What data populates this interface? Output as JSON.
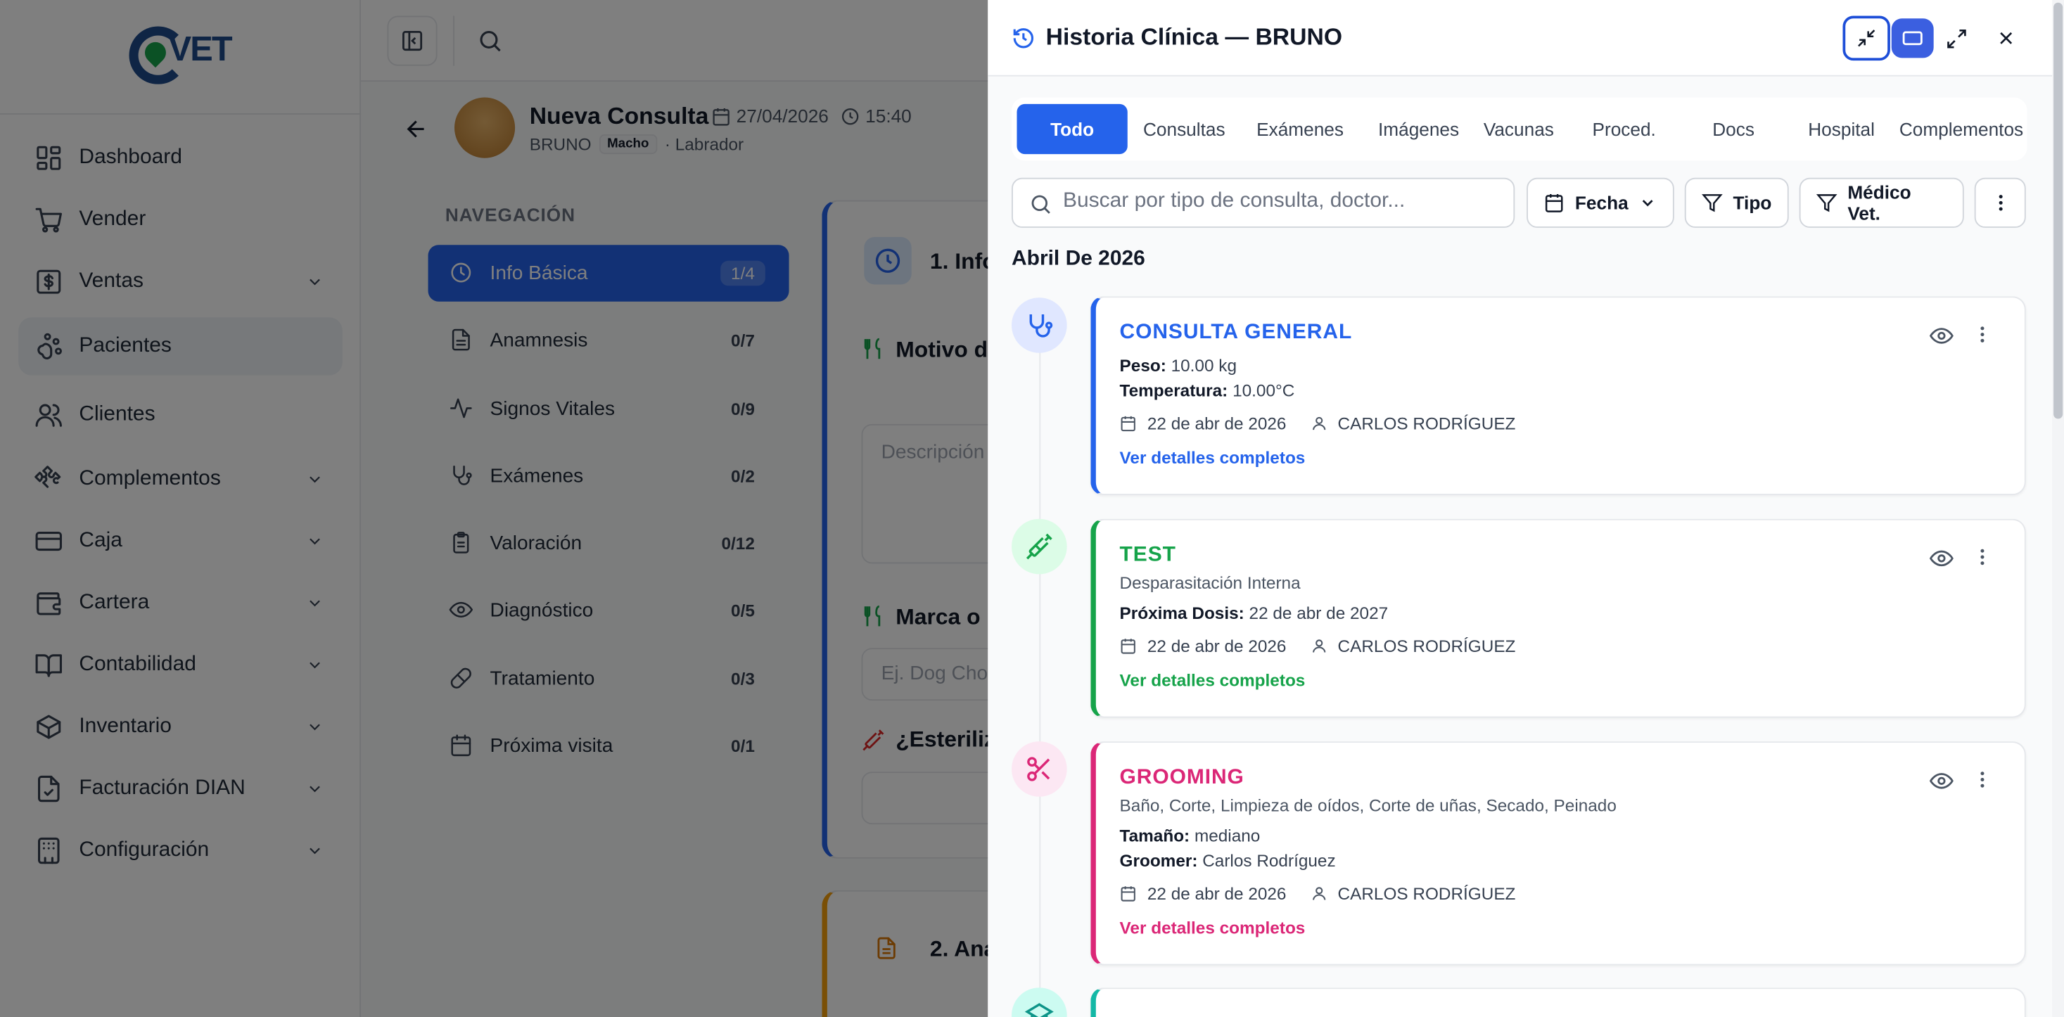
{
  "sidebar": {
    "logo_text": "VET",
    "items": [
      {
        "label": "Dashboard",
        "icon": "grid-icon",
        "chevron": false
      },
      {
        "label": "Vender",
        "icon": "cart-icon",
        "chevron": false
      },
      {
        "label": "Ventas",
        "icon": "dollar-icon",
        "chevron": true
      },
      {
        "label": "Pacientes",
        "icon": "paw-icon",
        "chevron": false,
        "active": true
      },
      {
        "label": "Clientes",
        "icon": "users-icon",
        "chevron": false
      },
      {
        "label": "Complementos",
        "icon": "puzzle-icon",
        "chevron": true
      },
      {
        "label": "Caja",
        "icon": "card-icon",
        "chevron": true
      },
      {
        "label": "Cartera",
        "icon": "wallet-icon",
        "chevron": true
      },
      {
        "label": "Contabilidad",
        "icon": "book-icon",
        "chevron": true
      },
      {
        "label": "Inventario",
        "icon": "box-icon",
        "chevron": true
      },
      {
        "label": "Facturación DIAN",
        "icon": "file-check-icon",
        "chevron": true
      },
      {
        "label": "Configuración",
        "icon": "building-icon",
        "chevron": true
      }
    ]
  },
  "consulta": {
    "title": "Nueva Consulta",
    "date": "27/04/2026",
    "time": "15:40",
    "pet_name": "BRUNO",
    "sex": "Macho",
    "breed": "· Labrador"
  },
  "steps": {
    "title": "NAVEGACIÓN",
    "items": [
      {
        "label": "Info Básica",
        "count": "1/4",
        "icon": "clock-icon"
      },
      {
        "label": "Anamnesis",
        "count": "0/7",
        "icon": "file-text-icon"
      },
      {
        "label": "Signos Vitales",
        "count": "0/9",
        "icon": "activity-icon"
      },
      {
        "label": "Exámenes",
        "count": "0/2",
        "icon": "stethoscope-icon"
      },
      {
        "label": "Valoración",
        "count": "0/12",
        "icon": "clipboard-icon"
      },
      {
        "label": "Diagnóstico",
        "count": "0/5",
        "icon": "eye-icon"
      },
      {
        "label": "Tratamiento",
        "count": "0/3",
        "icon": "pill-icon"
      },
      {
        "label": "Próxima visita",
        "count": "0/1",
        "icon": "calendar-icon"
      }
    ]
  },
  "form": {
    "section1": "1. Info",
    "motivo": "Motivo d",
    "desc_placeholder": "Descripción",
    "marca": "Marca o",
    "marca_placeholder": "Ej. Dog Cho",
    "esteril": "¿Esteriliz",
    "section2": "2. Ana"
  },
  "drawer": {
    "title": "Historia Clínica — BRUNO",
    "tabs": [
      "Todo",
      "Consultas",
      "Exámenes",
      "Imágenes",
      "Vacunas",
      "Proced.",
      "Docs",
      "Hospital",
      "Complementos"
    ],
    "search_placeholder": "Buscar por tipo de consulta, doctor...",
    "filters": {
      "fecha": "Fecha",
      "tipo": "Tipo",
      "medico": "Médico Vet."
    },
    "month": "Abril De 2026",
    "cards": [
      {
        "title": "CONSULTA GENERAL",
        "color": "#2563eb",
        "dot_bg": "#e0e7ff",
        "lines": [
          {
            "label": "Peso:",
            "value": " 10.00 kg"
          },
          {
            "label": "Temperatura:",
            "value": " 10.00°C"
          }
        ],
        "date": "22 de abr de 2026",
        "doctor": "CARLOS RODRÍGUEZ",
        "link": "Ver detalles completos"
      },
      {
        "title": "TEST",
        "color": "#16a34a",
        "dot_bg": "#dcfce7",
        "subtitle": "Desparasitación Interna",
        "lines": [
          {
            "label": "Próxima Dosis:",
            "value": " 22 de abr de 2027"
          }
        ],
        "date": "22 de abr de 2026",
        "doctor": "CARLOS RODRÍGUEZ",
        "link": "Ver detalles completos"
      },
      {
        "title": "GROOMING",
        "color": "#db2777",
        "dot_bg": "#fce7f3",
        "subtitle": "Baño, Corte, Limpieza de oídos, Corte de uñas, Secado, Peinado",
        "lines": [
          {
            "label": "Tamaño:",
            "value": " mediano"
          },
          {
            "label": "Groomer:",
            "value": " Carlos Rodríguez"
          }
        ],
        "date": "22 de abr de 2026",
        "doctor": "CARLOS RODRÍGUEZ",
        "link": "Ver detalles completos"
      }
    ],
    "partial_card_color": "#14b8a6"
  }
}
